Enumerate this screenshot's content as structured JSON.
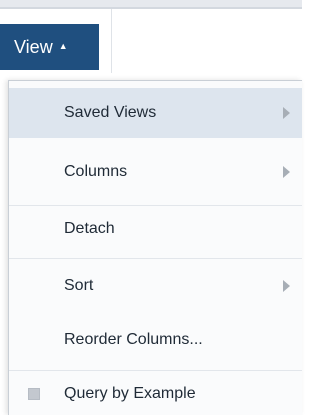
{
  "toolbar": {
    "view_label": "View",
    "caret": "▲"
  },
  "menu": {
    "items": [
      {
        "label": "Saved Views",
        "has_submenu": true,
        "highlighted": true
      },
      {
        "label": "Columns",
        "has_submenu": true
      },
      {
        "label": "Detach",
        "has_submenu": false
      },
      {
        "label": "Sort",
        "has_submenu": true
      },
      {
        "label": "Reorder Columns...",
        "has_submenu": false
      },
      {
        "label": "Query by Example",
        "has_submenu": false,
        "checkbox": true,
        "checked": false
      }
    ]
  },
  "colors": {
    "view_button_bg": "#1f4f7f",
    "menu_bg": "#fafbfc",
    "highlight_bg": "#dde5ee"
  },
  "icons": {
    "submenu": "chevron-right-icon",
    "caret": "caret-up-icon"
  }
}
